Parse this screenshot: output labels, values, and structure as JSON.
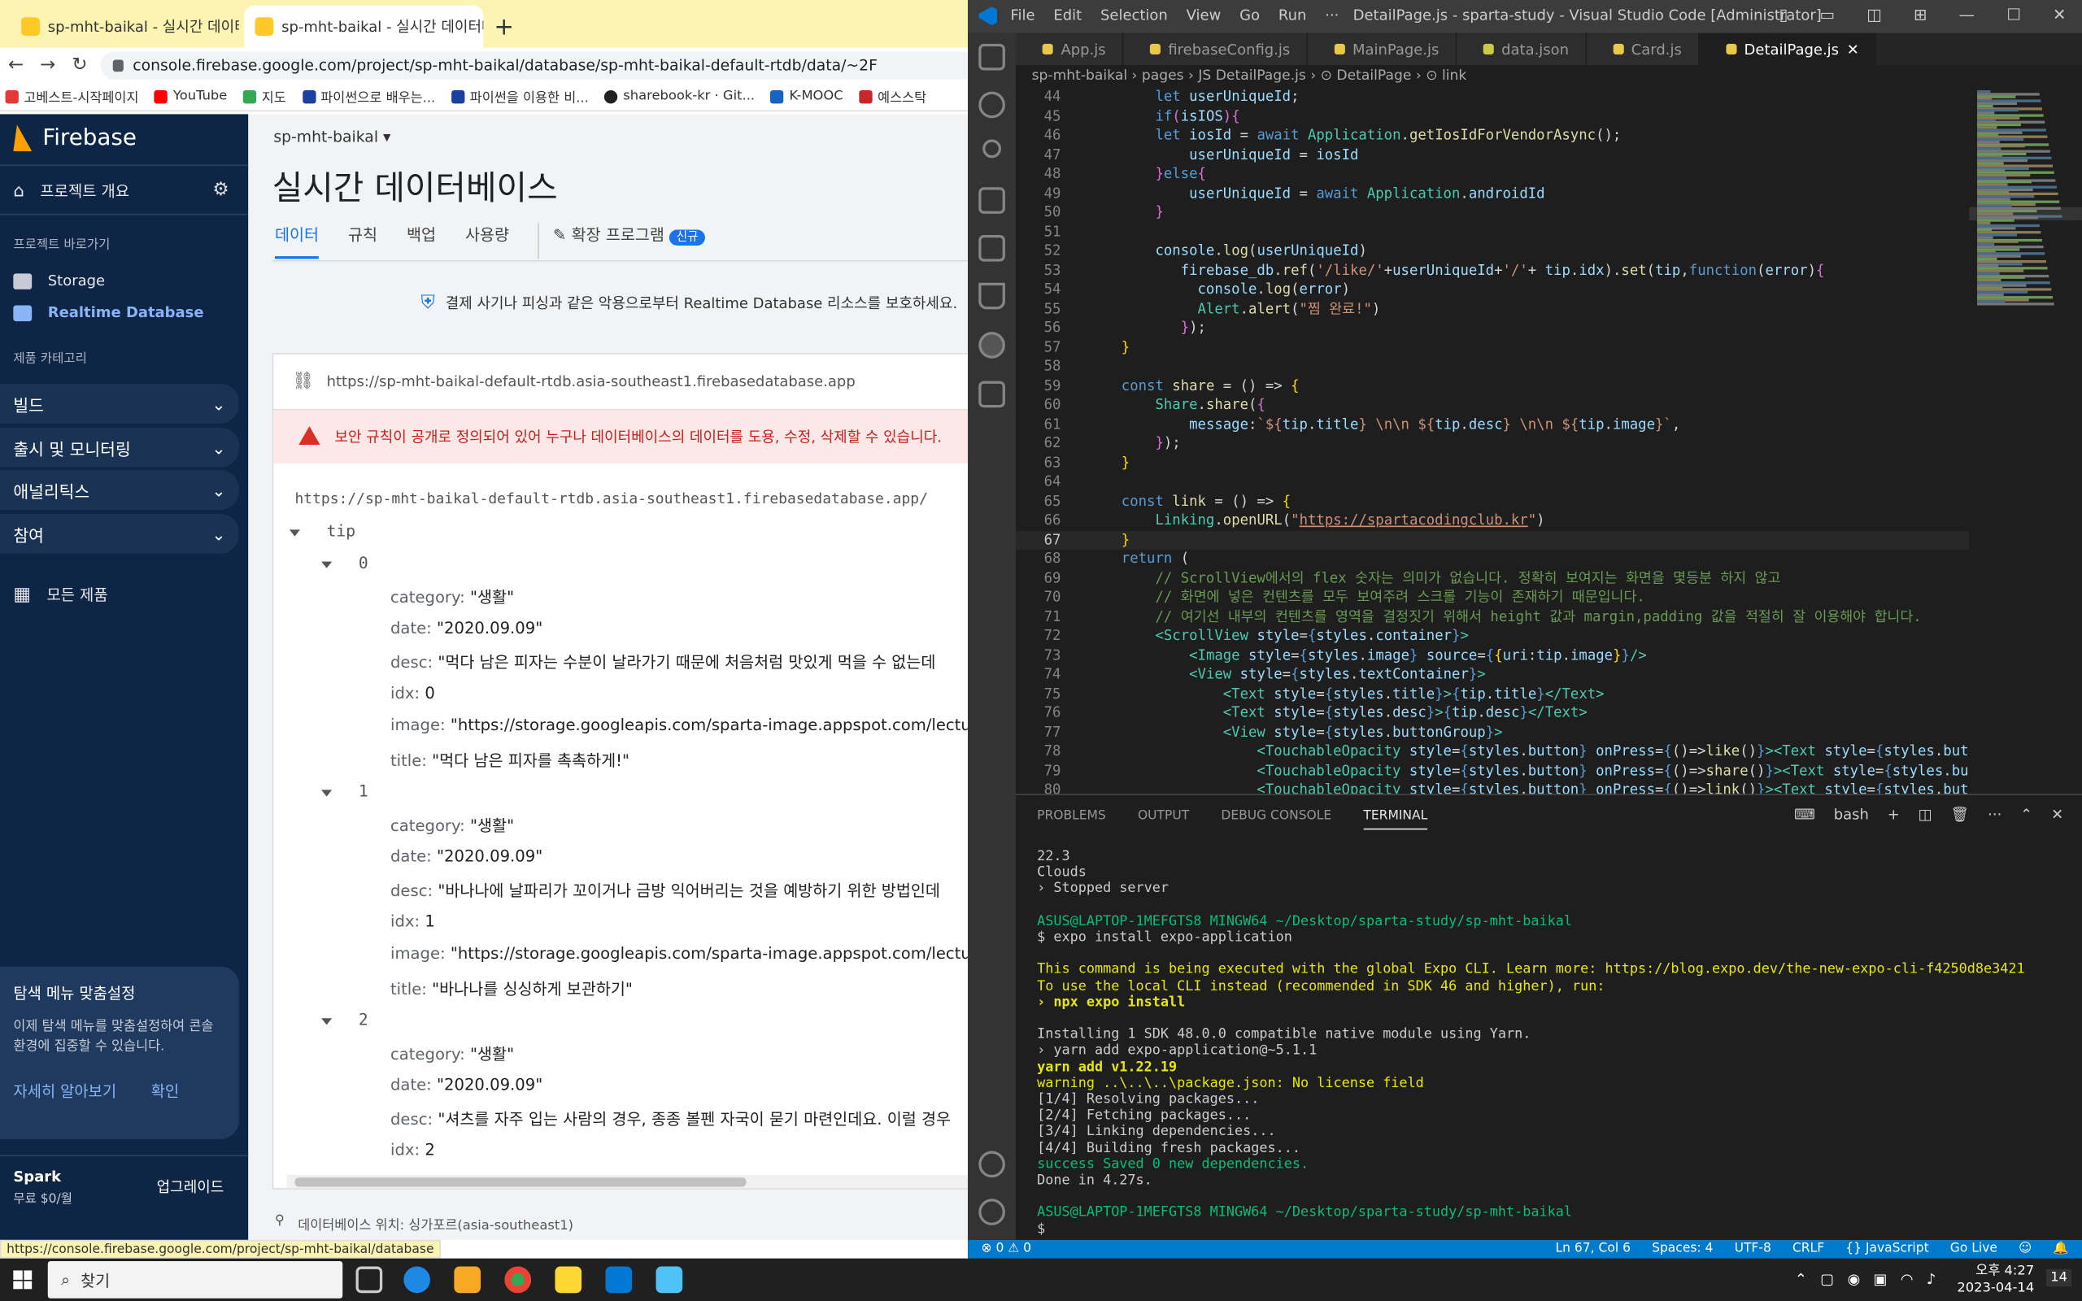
{
  "chrome": {
    "tabs": [
      "sp-mht-baikal - 실시간 데이터베",
      "sp-mht-baikal - 실시간 데이터베"
    ],
    "url": "console.firebase.google.com/project/sp-mht-baikal/database/sp-mht-baikal-default-rtdb/data/~2F",
    "bookmarks": [
      "고베스트-시작페이지",
      "YouTube",
      "지도",
      "파이썬으로 배우는...",
      "파이썬을 이용한 비...",
      "sharebook-kr · Git...",
      "K-MOOC",
      "예스스탁"
    ],
    "status_url": "https://console.firebase.google.com/project/sp-mht-baikal/database"
  },
  "firebase": {
    "brand": "Firebase",
    "overview": "프로젝트 개요",
    "shortcuts_title": "프로젝트 바로가기",
    "storage": "Storage",
    "rtdb": "Realtime Database",
    "category": "제품 카테고리",
    "accordions": [
      "빌드",
      "출시 및 모니터링",
      "애널리틱스",
      "참여"
    ],
    "all_products": "모든 제품",
    "custom_title": "탐색 메뉴 맞춤설정",
    "custom_desc": "이제 탐색 메뉴를 맞춤설정하여 콘솔 환경에 집중할 수 있습니다.",
    "learn_more": "자세히 알아보기",
    "confirm": "확인",
    "plan": "Spark",
    "plan_price": "무료 $0/월",
    "upgrade": "업그레이드",
    "project": "sp-mht-baikal",
    "page_title": "실시간 데이터베이스",
    "tabs": [
      "데이터",
      "규칙",
      "백업",
      "사용량",
      "확장 프로그램"
    ],
    "new_badge": "신규",
    "protect_text": "결제 사기나 피싱과 같은 악용으로부터 Realtime Database 리소스를 보호하세요.",
    "db_url": "https://sp-mht-baikal-default-rtdb.asia-southeast1.firebasedatabase.app",
    "warning": "보안 규칙이 공개로 정의되어 있어 누구나 데이터베이스의 데이터를 도용, 수정, 삭제할 수 있습니다.",
    "root_url": "https://sp-mht-baikal-default-rtdb.asia-southeast1.firebasedatabase.app/",
    "root_key": "tip",
    "items": [
      {
        "key": "0",
        "category": "\"생활\"",
        "date": "\"2020.09.09\"",
        "desc": "\"먹다 남은 피자는 수분이 날라가기 때문에 처음처럼 맛있게 먹을 수 없는데",
        "idx": "0",
        "image": "\"https://storage.googleapis.com/sparta-image.appspot.com/lecture/pizz",
        "title": "\"먹다 남은 피자를 촉촉하게!\""
      },
      {
        "key": "1",
        "category": "\"생활\"",
        "date": "\"2020.09.09\"",
        "desc": "\"바나나에 날파리가 꼬이거나 금방 익어버리는 것을 예방하기 위한 방법인데",
        "idx": "1",
        "image": "\"https://storage.googleapis.com/sparta-image.appspot.com/lecture/ban",
        "title": "\"바나나를 싱싱하게 보관하기\""
      },
      {
        "key": "2",
        "category": "\"생활\"",
        "date": "\"2020.09.09\"",
        "desc": "\"셔츠를 자주 입는 사람의 경우, 종종 볼펜 자국이 묻기 마련인데요. 이럴 경우",
        "idx": "2"
      }
    ],
    "db_location": "데이터베이스 위치: 싱가포르(asia-southeast1)"
  },
  "vscode": {
    "menu": [
      "File",
      "Edit",
      "Selection",
      "View",
      "Go",
      "Run",
      "···"
    ],
    "title": "DetailPage.js - sparta-study - Visual Studio Code [Administrator]",
    "tabs": [
      "App.js",
      "firebaseConfig.js",
      "MainPage.js",
      "data.json",
      "Card.js",
      "DetailPage.js"
    ],
    "breadcrumb": "sp-mht-baikal › pages › JS DetailPage.js › ⊙ DetailPage › ⊙ link",
    "line_numbers": [
      "44",
      "45",
      "46",
      "47",
      "48",
      "49",
      "50",
      "51",
      "52",
      "53",
      "54",
      "55",
      "56",
      "57",
      "58",
      "59",
      "60",
      "61",
      "62",
      "63",
      "64",
      "65",
      "66",
      "67",
      "68",
      "69",
      "70",
      "71",
      "72",
      "73",
      "74",
      "75",
      "76",
      "77",
      "78",
      "79",
      "80"
    ],
    "panel_tabs": [
      "PROBLEMS",
      "OUTPUT",
      "DEBUG CONSOLE",
      "TERMINAL"
    ],
    "shell": "bash",
    "terminal": [
      "22.3",
      "Clouds",
      "› Stopped server",
      "",
      "ASUS@LAPTOP-1MEFGTS8 MINGW64 ~/Desktop/sparta-study/sp-mht-baikal",
      "$ expo install expo-application",
      "",
      "This command is being executed with the global Expo CLI. Learn more: https://blog.expo.dev/the-new-expo-cli-f4250d8e3421",
      "To use the local CLI instead (recommended in SDK 46 and higher), run:",
      "› npx expo install",
      "",
      "Installing 1 SDK 48.0.0 compatible native module using Yarn.",
      "› yarn add expo-application@~5.1.1",
      "yarn add v1.22.19",
      "warning ..\\..\\..\\package.json: No license field",
      "[1/4] Resolving packages...",
      "[2/4] Fetching packages...",
      "[3/4] Linking dependencies...",
      "[4/4] Building fresh packages...",
      "success Saved 0 new dependencies.",
      "Done in 4.27s.",
      "",
      "ASUS@LAPTOP-1MEFGTS8 MINGW64 ~/Desktop/sparta-study/sp-mht-baikal",
      "$ "
    ],
    "status_left": "⊗ 0 ⚠ 0",
    "status_right": [
      "Ln 67, Col 6",
      "Spaces: 4",
      "UTF-8",
      "CRLF",
      "{} JavaScript",
      "Go Live"
    ]
  },
  "taskbar": {
    "search": "찾기",
    "time": "오후 4:27",
    "date": "2023-04-14",
    "notif": "14"
  }
}
